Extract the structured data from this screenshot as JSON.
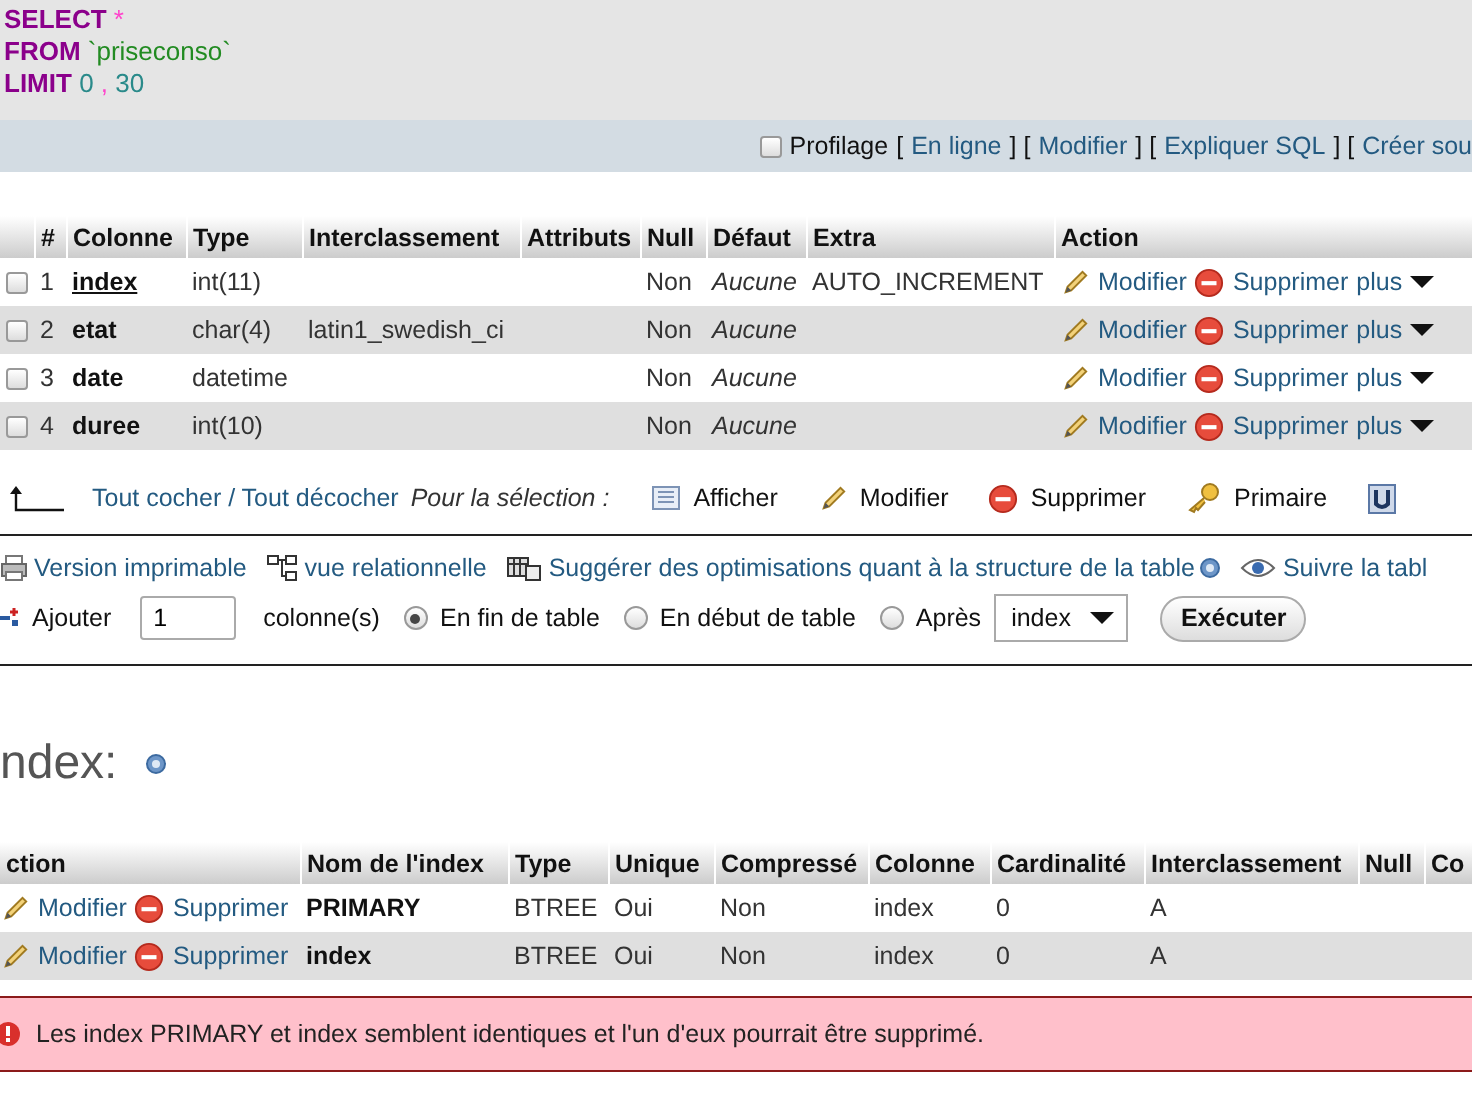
{
  "sql": {
    "lines": [
      {
        "keyword": "SELECT",
        "tokens": [
          {
            "text": "*",
            "kind": "punct"
          }
        ]
      },
      {
        "keyword": "FROM",
        "tokens": [
          {
            "text": "`priseconso`",
            "kind": "string"
          }
        ]
      },
      {
        "keyword": "LIMIT",
        "tokens": [
          {
            "text": "0",
            "kind": "number"
          },
          {
            "text": ",",
            "kind": "punct"
          },
          {
            "text": "30",
            "kind": "number"
          }
        ]
      }
    ]
  },
  "query_bar": {
    "profiling": {
      "label": "Profilage",
      "checked": false
    },
    "segments": [
      {
        "kind": "text",
        "text": "["
      },
      {
        "kind": "link",
        "text": "En ligne"
      },
      {
        "kind": "text",
        "text": "] ["
      },
      {
        "kind": "link",
        "text": "Modifier"
      },
      {
        "kind": "text",
        "text": "] ["
      },
      {
        "kind": "link",
        "text": "Expliquer SQL"
      },
      {
        "kind": "text",
        "text": "] ["
      },
      {
        "kind": "link",
        "text": "Créer sou"
      }
    ]
  },
  "structure": {
    "columns": [
      "#",
      "Colonne",
      "Type",
      "Interclassement",
      "Attributs",
      "Null",
      "Défaut",
      "Extra",
      "Action"
    ],
    "rows": [
      {
        "checked": false,
        "number": "1",
        "name": "index",
        "primary": true,
        "type": "int(11)",
        "null": "Non",
        "default": "Aucune",
        "extra": "AUTO_INCREMENT",
        "actions": [
          "Modifier",
          "Supprimer",
          "plus"
        ]
      },
      {
        "checked": false,
        "number": "2",
        "name": "etat",
        "primary": false,
        "type": "char(4)",
        "collation": "latin1_swedish_ci",
        "null": "Non",
        "default": "Aucune",
        "actions": [
          "Modifier",
          "Supprimer",
          "plus"
        ]
      },
      {
        "checked": false,
        "number": "3",
        "name": "date",
        "primary": false,
        "type": "datetime",
        "null": "Non",
        "default": "Aucune",
        "actions": [
          "Modifier",
          "Supprimer",
          "plus"
        ]
      },
      {
        "checked": false,
        "number": "4",
        "name": "duree",
        "primary": false,
        "type": "int(10)",
        "null": "Non",
        "default": "Aucune",
        "actions": [
          "Modifier",
          "Supprimer",
          "plus"
        ]
      }
    ],
    "footer": {
      "check_all": "Tout cocher / Tout décocher",
      "with_selected": "Pour la sélection :",
      "actions": [
        {
          "kind": "browse",
          "label": "Afficher"
        },
        {
          "kind": "edit",
          "label": "Modifier"
        },
        {
          "kind": "drop",
          "label": "Supprimer"
        },
        {
          "kind": "primary",
          "label": "Primaire"
        },
        {
          "kind": "unique"
        }
      ]
    }
  },
  "links": [
    {
      "kind": "print",
      "label": "Version imprimable"
    },
    {
      "kind": "relation",
      "label": "vue relationnelle"
    },
    {
      "kind": "propose",
      "label": "Suggérer des optimisations quant à la structure de la table",
      "help": true
    },
    {
      "kind": "track",
      "label": "Suivre la tabl"
    }
  ],
  "add_column": {
    "label": "Ajouter",
    "count": "1",
    "unit": "colonne(s)",
    "positions": [
      {
        "label": "En fin de table",
        "selected": true
      },
      {
        "label": "En début de table",
        "selected": false
      },
      {
        "label": "Après",
        "selected": false
      }
    ],
    "after": "index",
    "button": "Exécuter"
  },
  "indexes": {
    "title": "ndex:",
    "columns": [
      "ction",
      "Nom de l'index",
      "Type",
      "Unique",
      "Compressé",
      "Colonne",
      "Cardinalité",
      "Interclassement",
      "Null",
      "Co"
    ],
    "rows": [
      {
        "actions": [
          "Modifier",
          "Supprimer"
        ],
        "name": "PRIMARY",
        "type": "BTREE",
        "unique": "Oui",
        "packed": "Non",
        "column": "index",
        "cardinality": "0",
        "collation": "A"
      },
      {
        "actions": [
          "Modifier",
          "Supprimer"
        ],
        "name": "index",
        "type": "BTREE",
        "unique": "Oui",
        "packed": "Non",
        "column": "index",
        "cardinality": "0",
        "collation": "A"
      }
    ],
    "warning": "Les index PRIMARY et index semblent identiques et l'un d'eux pourrait être supprimé."
  }
}
